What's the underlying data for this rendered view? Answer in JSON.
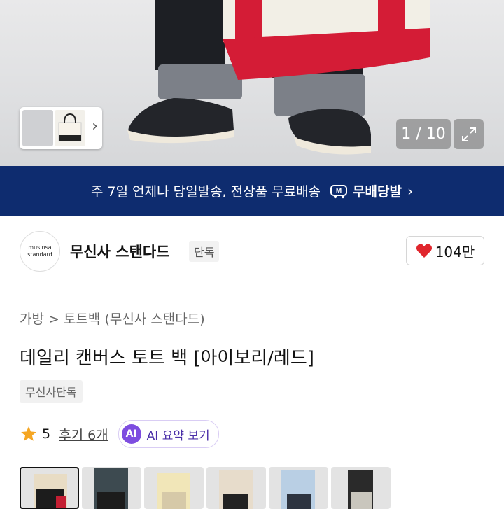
{
  "hero": {
    "counter": "1 / 10",
    "icons": [
      "chevron-right-icon",
      "expand-icon"
    ]
  },
  "banner": {
    "text": "주 7일 언제나 당일발송, 전상품 무료배송",
    "badge": "무배당발",
    "mark_icon": "M-truck-icon"
  },
  "brand": {
    "logo_line1": "musinsa",
    "logo_line2": "standard",
    "name": "무신사 스탠다드",
    "exclusive": "단독",
    "likes": "104만",
    "heart_color": "#e0262d"
  },
  "breadcrumb": "가방 > 토트백 (무신사 스탠다드)",
  "product": {
    "title": "데일리 캔버스 토트 백 [아이보리/레드]",
    "tag": "무신사단독"
  },
  "rating": {
    "score": "5",
    "reviews": "후기 6개",
    "ai_badge": "AI",
    "ai_label": "AI 요약 보기",
    "star_color": "#f5a623"
  },
  "swatches": [
    "ivory-red",
    "black",
    "ivory-beige",
    "beige-black",
    "blue",
    "grey"
  ]
}
